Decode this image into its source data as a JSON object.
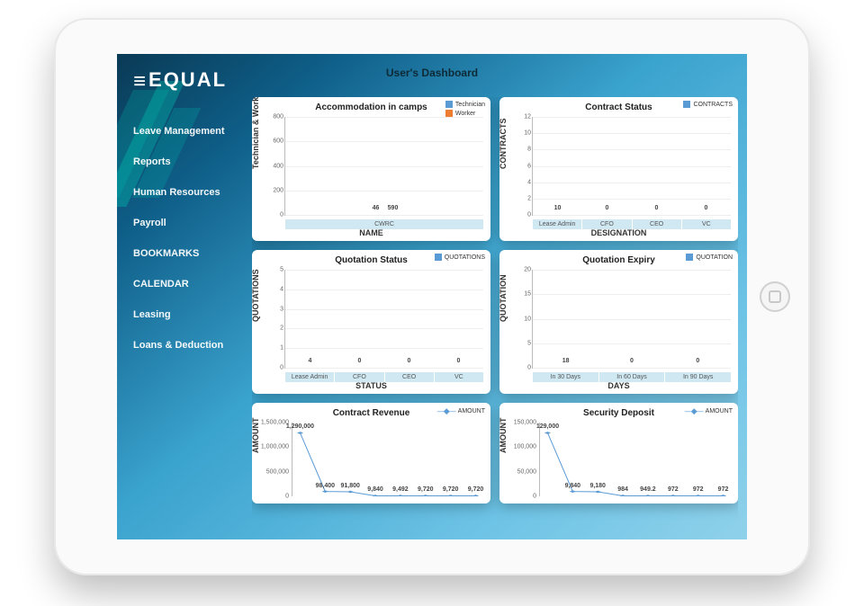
{
  "brand": "EQUAL",
  "page_title": "User's Dashboard",
  "sidebar": {
    "items": [
      {
        "label": "Leave Management"
      },
      {
        "label": "Reports"
      },
      {
        "label": "Human Resources"
      },
      {
        "label": "Payroll"
      },
      {
        "label": "BOOKMARKS"
      },
      {
        "label": "CALENDAR"
      },
      {
        "label": "Leasing"
      },
      {
        "label": "Loans & Deduction"
      }
    ]
  },
  "cards": {
    "accommodation": {
      "title": "Accommodation in camps",
      "xlabel": "NAME",
      "ylabel": "Technician & Worker",
      "legend": [
        {
          "name": "Technician",
          "color": "blue"
        },
        {
          "name": "Worker",
          "color": "orange"
        }
      ],
      "categories": [
        "CWRC"
      ],
      "ylim": [
        0,
        800
      ],
      "yticks": [
        0,
        200,
        400,
        600,
        800
      ],
      "series": [
        {
          "name": "Technician",
          "color": "blue",
          "values": [
            46
          ]
        },
        {
          "name": "Worker",
          "color": "orange",
          "values": [
            590
          ]
        }
      ]
    },
    "contract_status": {
      "title": "Contract Status",
      "xlabel": "DESIGNATION",
      "ylabel": "CONTRACTS",
      "legend": [
        {
          "name": "CONTRACTS",
          "color": "blue"
        }
      ],
      "categories": [
        "Lease Admin",
        "CFO",
        "CEO",
        "VC"
      ],
      "ylim": [
        0,
        12
      ],
      "yticks": [
        0,
        2,
        4,
        6,
        8,
        10,
        12
      ],
      "values": [
        10,
        0,
        0,
        0
      ]
    },
    "quotation_status": {
      "title": "Quotation Status",
      "xlabel": "STATUS",
      "ylabel": "QUOTATIONS",
      "legend": [
        {
          "name": "QUOTATIONS",
          "color": "blue"
        }
      ],
      "categories": [
        "Lease Admin",
        "CFO",
        "CEO",
        "VC"
      ],
      "ylim": [
        0,
        5
      ],
      "yticks": [
        0,
        1,
        2,
        3,
        4,
        5
      ],
      "values": [
        4,
        0,
        0,
        0
      ]
    },
    "quotation_expiry": {
      "title": "Quotation Expiry",
      "xlabel": "DAYS",
      "ylabel": "QUOTATION",
      "legend": [
        {
          "name": "QUOTATION",
          "color": "blue"
        }
      ],
      "categories": [
        "In 30 Days",
        "In 60 Days",
        "In 90 Days"
      ],
      "ylim": [
        0,
        20
      ],
      "yticks": [
        0,
        5,
        10,
        15,
        20
      ],
      "values": [
        18,
        0,
        0
      ]
    },
    "contract_revenue": {
      "title": "Contract Revenue",
      "ylabel": "AMOUNT",
      "legend_name": "AMOUNT",
      "ylim": [
        0,
        1500000
      ],
      "yticks": [
        0,
        500000,
        1000000,
        1500000
      ],
      "values": [
        1290000,
        98400,
        91800,
        9840,
        9492,
        9720,
        9720,
        9720
      ]
    },
    "security_deposit": {
      "title": "Security Deposit",
      "ylabel": "AMOUNT",
      "legend_name": "AMOUNT",
      "ylim": [
        0,
        150000
      ],
      "yticks": [
        0,
        50000,
        100000,
        150000
      ],
      "values": [
        129000,
        9840,
        9180,
        984,
        949.2,
        972,
        972,
        972
      ]
    }
  },
  "chart_data": [
    {
      "type": "bar",
      "title": "Accommodation in camps",
      "xlabel": "NAME",
      "ylabel": "Technician & Worker",
      "categories": [
        "CWRC"
      ],
      "ylim": [
        0,
        800
      ],
      "series": [
        {
          "name": "Technician",
          "values": [
            46
          ]
        },
        {
          "name": "Worker",
          "values": [
            590
          ]
        }
      ]
    },
    {
      "type": "bar",
      "title": "Contract Status",
      "xlabel": "DESIGNATION",
      "ylabel": "CONTRACTS",
      "categories": [
        "Lease Admin",
        "CFO",
        "CEO",
        "VC"
      ],
      "ylim": [
        0,
        12
      ],
      "series": [
        {
          "name": "CONTRACTS",
          "values": [
            10,
            0,
            0,
            0
          ]
        }
      ]
    },
    {
      "type": "bar",
      "title": "Quotation Status",
      "xlabel": "STATUS",
      "ylabel": "QUOTATIONS",
      "categories": [
        "Lease Admin",
        "CFO",
        "CEO",
        "VC"
      ],
      "ylim": [
        0,
        5
      ],
      "series": [
        {
          "name": "QUOTATIONS",
          "values": [
            4,
            0,
            0,
            0
          ]
        }
      ]
    },
    {
      "type": "bar",
      "title": "Quotation Expiry",
      "xlabel": "DAYS",
      "ylabel": "QUOTATION",
      "categories": [
        "In 30 Days",
        "In 60 Days",
        "In 90 Days"
      ],
      "ylim": [
        0,
        20
      ],
      "series": [
        {
          "name": "QUOTATION",
          "values": [
            18,
            0,
            0
          ]
        }
      ]
    },
    {
      "type": "line",
      "title": "Contract Revenue",
      "xlabel": "",
      "ylabel": "AMOUNT",
      "ylim": [
        0,
        1500000
      ],
      "series": [
        {
          "name": "AMOUNT",
          "values": [
            1290000,
            98400,
            91800,
            9840,
            9492,
            9720,
            9720,
            9720
          ]
        }
      ]
    },
    {
      "type": "line",
      "title": "Security Deposit",
      "xlabel": "",
      "ylabel": "AMOUNT",
      "ylim": [
        0,
        150000
      ],
      "series": [
        {
          "name": "AMOUNT",
          "values": [
            129000,
            9840,
            9180,
            984,
            949.2,
            972,
            972,
            972
          ]
        }
      ]
    }
  ]
}
